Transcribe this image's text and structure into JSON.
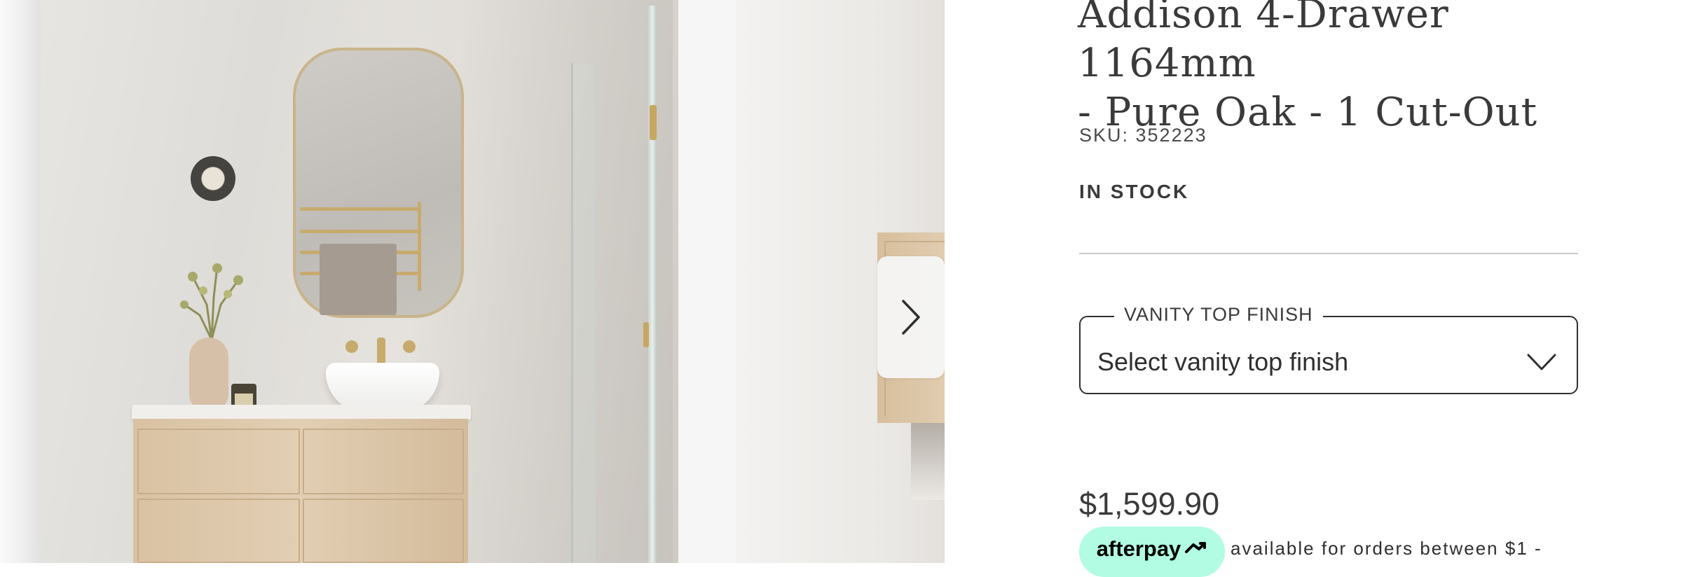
{
  "product": {
    "title_line1": "Addison 4-Drawer 1164mm",
    "title_line2": "- Pure Oak - 1 Cut-Out",
    "sku": "SKU: 352223",
    "stock_status": "IN STOCK"
  },
  "vanity_top": {
    "legend": "VANITY TOP FINISH",
    "selected": "Select vanity top finish"
  },
  "pricing": {
    "price": "$1,599.90",
    "afterpay_label": "afterpay",
    "afterpay_note": "available for orders between $1 -"
  },
  "gallery": {
    "next_icon": "chevron-right-icon"
  },
  "colors": {
    "afterpay_mint": "#b2fce4",
    "text_dark": "#2f2f2f",
    "divider": "#c9c9c9"
  }
}
